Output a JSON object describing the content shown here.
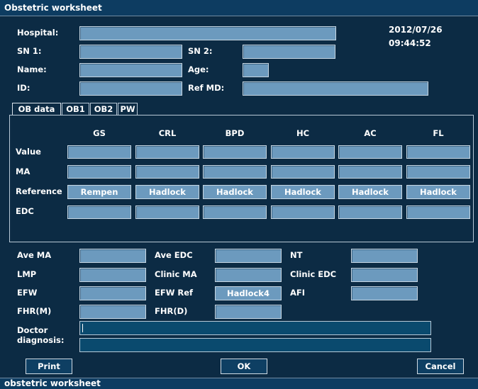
{
  "window": {
    "title": "Obstetric worksheet"
  },
  "status_bar": {
    "text": "obstetric worksheet"
  },
  "datetime": {
    "date": "2012/07/26",
    "time": "09:44:52"
  },
  "patient": {
    "hospital_label": "Hospital:",
    "sn1_label": "SN 1:",
    "sn2_label": "SN 2:",
    "name_label": "Name:",
    "age_label": "Age:",
    "id_label": "ID:",
    "refmd_label": "Ref MD:",
    "hospital_value": "",
    "sn1_value": "",
    "sn2_value": "",
    "name_value": "",
    "age_value": "",
    "id_value": "",
    "refmd_value": ""
  },
  "tabs": [
    "OB data",
    "OB1",
    "OB2",
    "PW"
  ],
  "ob_table": {
    "columns": [
      "GS",
      "CRL",
      "BPD",
      "HC",
      "AC",
      "FL"
    ],
    "row_labels": {
      "value": "Value",
      "ma": "MA",
      "reference": "Reference",
      "edc": "EDC"
    },
    "references": [
      "Rempen",
      "Hadlock",
      "Hadlock",
      "Hadlock",
      "Hadlock",
      "Hadlock"
    ]
  },
  "summary": {
    "ave_ma": "Ave MA",
    "ave_edc": "Ave EDC",
    "nt": "NT",
    "lmp": "LMP",
    "clinic_ma": "Clinic MA",
    "clinic_edc": "Clinic EDC",
    "efw": "EFW",
    "efw_ref": "EFW Ref",
    "efw_ref_value": "Hadlock4",
    "afi": "AFI",
    "fhr_m": "FHR(M)",
    "fhr_d": "FHR(D)"
  },
  "diagnosis": {
    "label_line1": "Doctor",
    "label_line2": "diagnosis:",
    "line1": "",
    "line2": ""
  },
  "buttons": {
    "print": "Print",
    "ok": "OK",
    "cancel": "Cancel"
  },
  "colors": {
    "background": "#0c2b44",
    "field": "#6c9abe",
    "dark_field": "#0a4a6e",
    "bar": "#0d3c61"
  }
}
